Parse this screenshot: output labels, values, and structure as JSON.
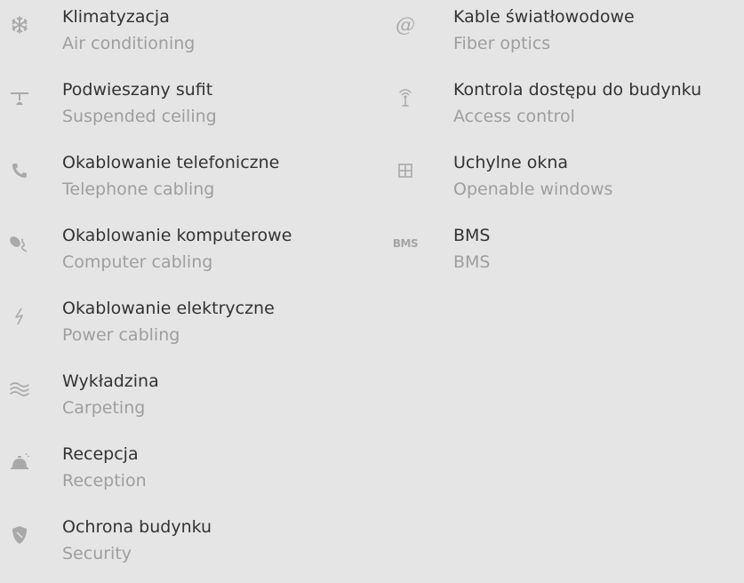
{
  "left_column": [
    {
      "title": "Klimatyzacja",
      "subtitle": "Air conditioning",
      "icon": "snowflake-icon"
    },
    {
      "title": "Podwieszany sufit",
      "subtitle": "Suspended ceiling",
      "icon": "ceiling-lamp-icon"
    },
    {
      "title": "Okablowanie telefoniczne",
      "subtitle": "Telephone cabling",
      "icon": "phone-icon"
    },
    {
      "title": "Okablowanie komputerowe",
      "subtitle": "Computer cabling",
      "icon": "mouse-cable-icon"
    },
    {
      "title": "Okablowanie elektryczne",
      "subtitle": "Power cabling",
      "icon": "lightning-icon"
    },
    {
      "title": "Wykładzina",
      "subtitle": "Carpeting",
      "icon": "waves-icon"
    },
    {
      "title": "Recepcja",
      "subtitle": "Reception",
      "icon": "service-bell-icon"
    },
    {
      "title": "Ochrona budynku",
      "subtitle": "Security",
      "icon": "shield-icon"
    }
  ],
  "right_column": [
    {
      "title": "Kable światłowodowe",
      "subtitle": "Fiber optics",
      "icon": "at-sign-icon"
    },
    {
      "title": "Kontrola dostępu do budynku",
      "subtitle": "Access control",
      "icon": "antenna-icon"
    },
    {
      "title": "Uchylne okna",
      "subtitle": "Openable windows",
      "icon": "window-icon"
    },
    {
      "title": "BMS",
      "subtitle": "BMS",
      "icon": "bms-icon",
      "icon_text": "BMS"
    }
  ],
  "colors": {
    "background": "#e5e5e5",
    "title": "#333333",
    "subtitle": "#9e9e9e",
    "icon": "#a9a9a9"
  }
}
